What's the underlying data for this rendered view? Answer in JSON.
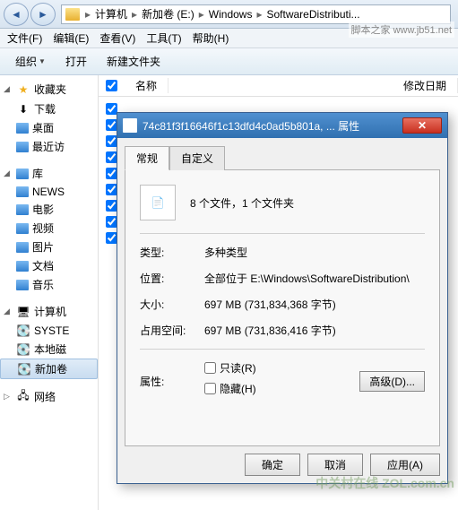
{
  "breadcrumb": [
    "计算机",
    "新加卷 (E:)",
    "Windows",
    "SoftwareDistributi..."
  ],
  "menubar": [
    "文件(F)",
    "编辑(E)",
    "查看(V)",
    "工具(T)",
    "帮助(H)"
  ],
  "toolbar": {
    "organize": "组织",
    "open": "打开",
    "newfolder": "新建文件夹"
  },
  "columns": {
    "name": "名称",
    "modified": "修改日期"
  },
  "sidebar": {
    "favorites": {
      "label": "收藏夹",
      "items": [
        "下载",
        "桌面",
        "最近访"
      ]
    },
    "libraries": {
      "label": "库",
      "items": [
        "NEWS",
        "电影",
        "视频",
        "图片",
        "文档",
        "音乐"
      ]
    },
    "computer": {
      "label": "计算机",
      "items": [
        "SYSTE",
        "本地磁",
        "新加卷"
      ]
    },
    "network": {
      "label": "网络"
    }
  },
  "dialog": {
    "title": "74c81f3f16646f1c13dfd4c0ad5b801a, ... 属性",
    "tabs": [
      "常规",
      "自定义"
    ],
    "summary": "8 个文件，1 个文件夹",
    "type_label": "类型:",
    "type_val": "多种类型",
    "loc_label": "位置:",
    "loc_val": "全部位于 E:\\Windows\\SoftwareDistribution\\",
    "size_label": "大小:",
    "size_val": "697 MB (731,834,368 字节)",
    "disk_label": "占用空间:",
    "disk_val": "697 MB (731,836,416 字节)",
    "attr_label": "属性:",
    "readonly": "只读(R)",
    "hidden": "隐藏(H)",
    "advanced": "高级(D)...",
    "ok": "确定",
    "cancel": "取消",
    "apply": "应用(A)"
  },
  "watermark": "脚本之家\nwww.jb51.net",
  "watermark2": "中关村在线\nZOL.com.cn"
}
